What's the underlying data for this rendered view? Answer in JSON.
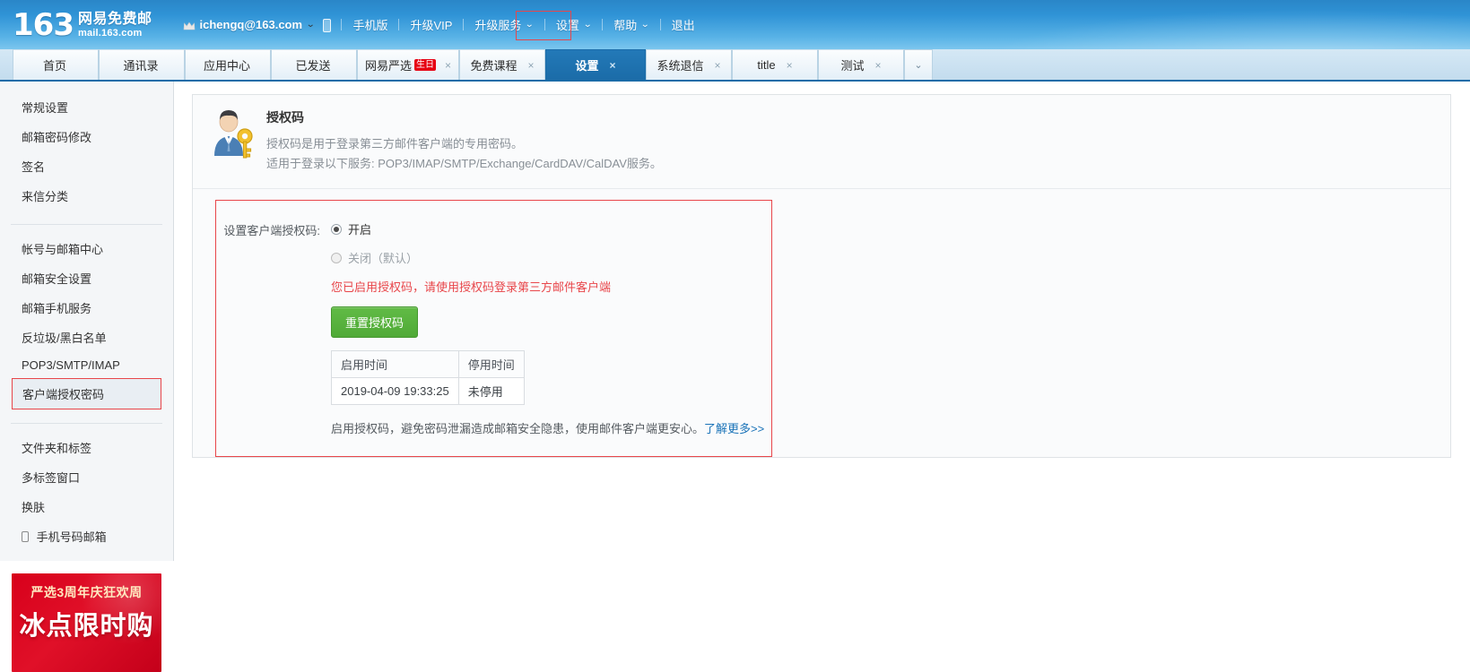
{
  "header": {
    "logo_number": "163",
    "logo_cn": "网易免费邮",
    "logo_en": "mail.163.com",
    "user_email": "ichengq@163.com",
    "crown_icon": "crown-icon",
    "mobile_icon": "mobile-device-icon",
    "nav": [
      {
        "label": "手机版",
        "caret": false
      },
      {
        "label": "升级VIP",
        "caret": false
      },
      {
        "label": "升级服务",
        "caret": true
      },
      {
        "label": "设置",
        "caret": true,
        "highlight": true
      },
      {
        "label": "帮助",
        "caret": true
      },
      {
        "label": "退出",
        "caret": false
      }
    ],
    "highlight_color": "#e8464a"
  },
  "tabs": {
    "items": [
      {
        "label": "首页",
        "closable": false,
        "active": false
      },
      {
        "label": "通讯录",
        "closable": false,
        "active": false
      },
      {
        "label": "应用中心",
        "closable": false,
        "active": false
      },
      {
        "label": "已发送",
        "closable": false,
        "active": false
      },
      {
        "label": "网易严选",
        "badge": "生日",
        "closable": true,
        "active": false
      },
      {
        "label": "免费课程",
        "closable": true,
        "active": false
      },
      {
        "label": "设置",
        "closable": true,
        "active": true
      },
      {
        "label": "系统退信",
        "closable": true,
        "active": false
      },
      {
        "label": "title",
        "closable": true,
        "active": false
      },
      {
        "label": "测试",
        "closable": true,
        "active": false
      }
    ],
    "close_glyph": "×",
    "more_icon": "chevron-down-icon",
    "active_color": "#1b6ca8"
  },
  "sidebar": {
    "group1": [
      {
        "label": "常规设置"
      },
      {
        "label": "邮箱密码修改"
      },
      {
        "label": "签名"
      },
      {
        "label": "来信分类"
      }
    ],
    "group2": [
      {
        "label": "帐号与邮箱中心"
      },
      {
        "label": "邮箱安全设置"
      },
      {
        "label": "邮箱手机服务"
      },
      {
        "label": "反垃圾/黑白名单"
      },
      {
        "label": "POP3/SMTP/IMAP"
      },
      {
        "label": "客户端授权密码",
        "selected": true
      }
    ],
    "group3": [
      {
        "label": "文件夹和标签"
      },
      {
        "label": "多标签窗口"
      },
      {
        "label": "换肤"
      },
      {
        "label": "手机号码邮箱",
        "icon": "phone-icon"
      }
    ],
    "promo": {
      "line1": "严选3周年庆狂欢周",
      "line2": "冰点限时购",
      "bg_color": "#d8001b"
    }
  },
  "main": {
    "avatar_icon": "user-with-key-icon",
    "title": "授权码",
    "sub1": "授权码是用于登录第三方邮件客户端的专用密码。",
    "sub2": "适用于登录以下服务: POP3/IMAP/SMTP/Exchange/CardDAV/CalDAV服务。",
    "form_label": "设置客户端授权码:",
    "radio_on": "开启",
    "radio_off": "关闭（默认）",
    "radio_selected": "开启",
    "warning": "您已启用授权码，请使用授权码登录第三方邮件客户端",
    "reset_button": "重置授权码",
    "table": {
      "headers": [
        "启用时间",
        "停用时间"
      ],
      "rows": [
        [
          "2019-04-09 19:33:25",
          "未停用"
        ]
      ]
    },
    "footnote": "启用授权码，避免密码泄漏造成邮箱安全隐患，使用邮件客户端更安心。",
    "footnote_link": "了解更多>>",
    "warning_color": "#e8464a",
    "button_color": "#4faa36",
    "link_color": "#1a73b8"
  }
}
